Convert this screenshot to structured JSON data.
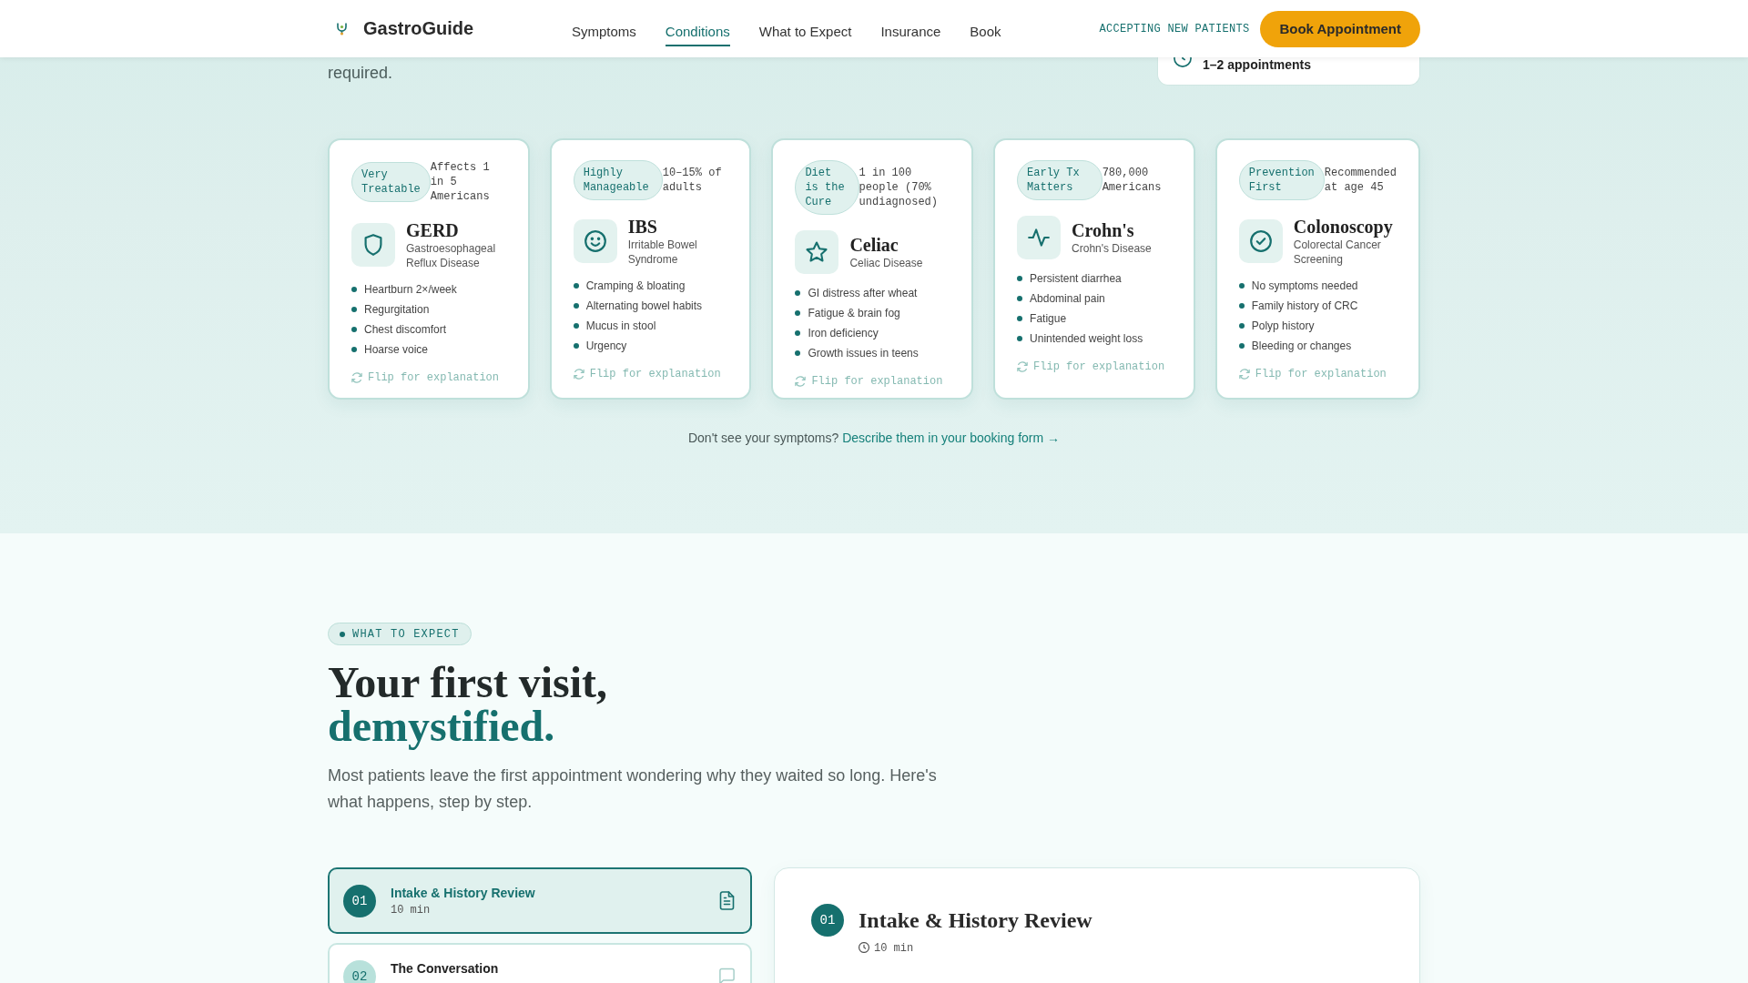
{
  "header": {
    "brand": "GastroGuide",
    "nav": [
      {
        "label": "Symptoms",
        "selected": false
      },
      {
        "label": "Conditions",
        "selected": true
      },
      {
        "label": "What to Expect",
        "selected": false
      },
      {
        "label": "Insurance",
        "selected": false
      },
      {
        "label": "Book",
        "selected": false
      }
    ],
    "status": "ACCEPTING NEW PATIENTS",
    "cta": "Book Appointment"
  },
  "intro": {
    "text": "required.",
    "info_card": {
      "value": "1–2 appointments"
    }
  },
  "conditions": {
    "cards": [
      {
        "kind": "shield",
        "badge": "Very Treatable",
        "stat": "Affects 1 in 5 Americans",
        "title": "GERD",
        "subtitle": "Gastroesophageal Reflux Disease",
        "symptoms": [
          "Heartburn 2×/week",
          "Regurgitation",
          "Chest discomfort",
          "Hoarse voice"
        ],
        "action": "Flip for explanation"
      },
      {
        "kind": "smile",
        "badge": "Highly Manageable",
        "stat": "10–15% of adults",
        "title": "IBS",
        "subtitle": "Irritable Bowel Syndrome",
        "symptoms": [
          "Cramping & bloating",
          "Alternating bowel habits",
          "Mucus in stool",
          "Urgency"
        ],
        "action": "Flip for explanation"
      },
      {
        "kind": "star",
        "badge": "Diet is the Cure",
        "stat": "1 in 100 people (70% undiagnosed)",
        "title": "Celiac",
        "subtitle": "Celiac Disease",
        "symptoms": [
          "GI distress after wheat",
          "Fatigue & brain fog",
          "Iron deficiency",
          "Growth issues in teens"
        ],
        "action": "Flip for explanation"
      },
      {
        "kind": "pulse",
        "badge": "Early Tx Matters",
        "stat": "780,000 Americans",
        "title": "Crohn's",
        "subtitle": "Crohn's Disease",
        "symptoms": [
          "Persistent diarrhea",
          "Abdominal pain",
          "Fatigue",
          "Unintended weight loss"
        ],
        "action": "Flip for explanation"
      },
      {
        "kind": "check",
        "badge": "Prevention First",
        "stat": "Recommended at age 45",
        "title": "Colonoscopy",
        "subtitle": "Colorectal Cancer Screening",
        "symptoms": [
          "No symptoms needed",
          "Family history of CRC",
          "Polyp history",
          "Bleeding or changes"
        ],
        "action": "Flip for explanation"
      }
    ],
    "note": {
      "text": "Don't see your symptoms?",
      "link": "Describe them in your booking form →"
    }
  },
  "what_to_expect": {
    "eyebrow": "WHAT TO EXPECT",
    "heading": "Your first visit,",
    "heading_accent": "demystified.",
    "lead": "Most patients leave the first appointment wondering why they waited so long. Here's what happens, step by step.",
    "steps": [
      {
        "kind": "document",
        "number": "01",
        "title": "Intake & History Review",
        "duration": "10 min",
        "selected": true
      },
      {
        "kind": "chat",
        "number": "02",
        "title": "The Conversation",
        "selected": false
      }
    ],
    "detail": {
      "number": "01",
      "title": "Intake & History Review",
      "duration": "10 min"
    }
  }
}
